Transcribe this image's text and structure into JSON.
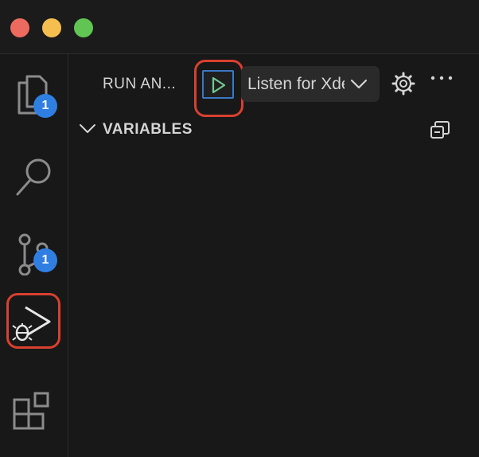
{
  "activity_bar": {
    "explorer_badge": "1",
    "scm_badge": "1"
  },
  "run_panel": {
    "title": "RUN AN...",
    "config_value": "Listen for Xdebug",
    "variables_title": "VARIABLES"
  },
  "colors": {
    "highlight": "#d9402f",
    "badge": "#2f7fe3",
    "play_green": "#73c991"
  }
}
